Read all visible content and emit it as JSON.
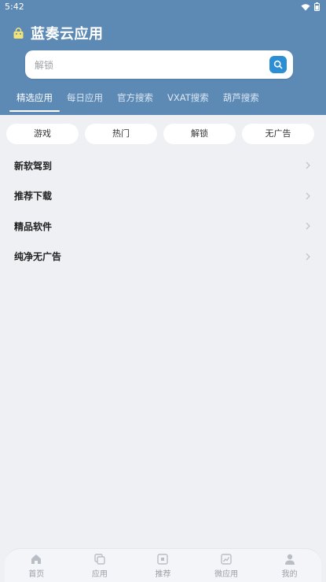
{
  "status": {
    "time": "5:42"
  },
  "app": {
    "title": "蓝奏云应用"
  },
  "search": {
    "placeholder": "解锁"
  },
  "tabs": [
    {
      "label": "精选应用",
      "active": true
    },
    {
      "label": "每日应用",
      "active": false
    },
    {
      "label": "官方搜索",
      "active": false
    },
    {
      "label": "VXAT搜索",
      "active": false
    },
    {
      "label": "葫芦搜索",
      "active": false
    }
  ],
  "chips": [
    {
      "label": "游戏"
    },
    {
      "label": "热门"
    },
    {
      "label": "解锁"
    },
    {
      "label": "无广告"
    }
  ],
  "list": [
    {
      "label": "新软驾到"
    },
    {
      "label": "推荐下载"
    },
    {
      "label": "精品软件"
    },
    {
      "label": "纯净无广告"
    }
  ],
  "nav": [
    {
      "label": "首页",
      "icon": "home-icon"
    },
    {
      "label": "应用",
      "icon": "apps-icon"
    },
    {
      "label": "推荐",
      "icon": "recommend-icon"
    },
    {
      "label": "微应用",
      "icon": "micro-app-icon"
    },
    {
      "label": "我的",
      "icon": "profile-icon"
    }
  ],
  "colors": {
    "header": "#5d8ab5",
    "accent": "#2c8fd6",
    "background": "#eef0f4"
  }
}
